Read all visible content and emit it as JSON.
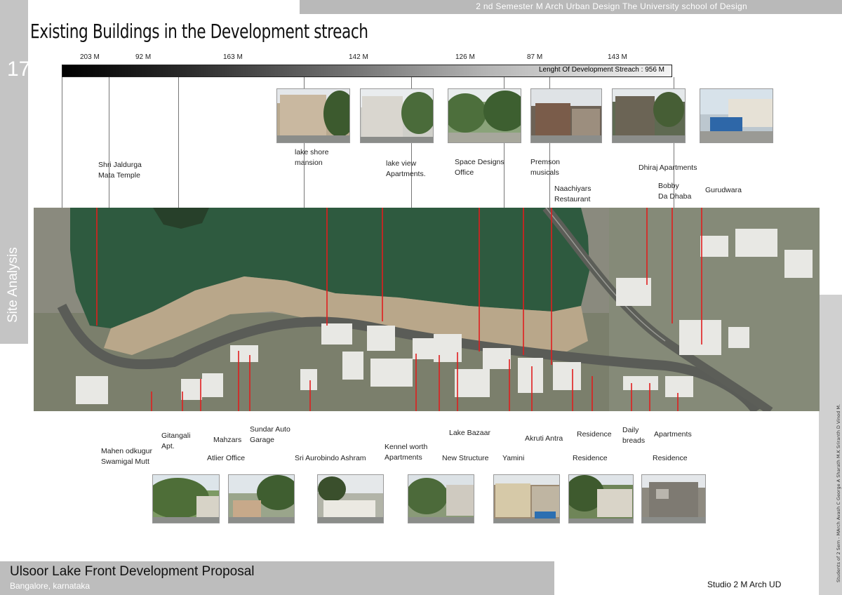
{
  "header": {
    "semester_line": "2 nd Semester  M Arch  Urban Design   The University school  of Design",
    "title": "Existing Buildings in the Development streach",
    "page_number": "17",
    "side_label": "Site  Analysis"
  },
  "distance_bar": {
    "segments": [
      "203 M",
      "92 M",
      "163 M",
      "142 M",
      "126 M",
      "87 M",
      "143 M"
    ],
    "total_label": "Lenght Of Development Streach : 956 M"
  },
  "labels_top": [
    "Shri Jaldurga\nMata Temple",
    "lake shore\nmansion",
    "lake view\nApartments.",
    "Space Designs\nOffice",
    "Premson\nmusicals",
    "Naachiyars\nRestaurant",
    "Dhiraj Apartments",
    "Bobby\nDa Dhaba",
    "Gurudwara"
  ],
  "labels_bottom": [
    "Mahen odkugur\nSwamigal Mutt",
    "Gitangali\nApt.",
    "Atlier Office",
    "Mahzars",
    "Sundar Auto\nGarage",
    "Sri Aurobindo Ashram",
    "Kennel worth\nApartments",
    "New Structure",
    "Lake Bazaar",
    "Yamini",
    "Akruti Antra",
    "Residence",
    "Residence",
    "Daily\nbreads",
    "Apartments",
    "Residence"
  ],
  "right_credits": "Students of   2 Sem  - MArch     Avash C George A   Sharath M.K   Sriranth D   Vinod M.",
  "footer": {
    "project_title": "Ulsoor Lake Front Development Proposal",
    "location": "Bangalore, karnataka",
    "studio": "Studio 2  M Arch UD"
  }
}
